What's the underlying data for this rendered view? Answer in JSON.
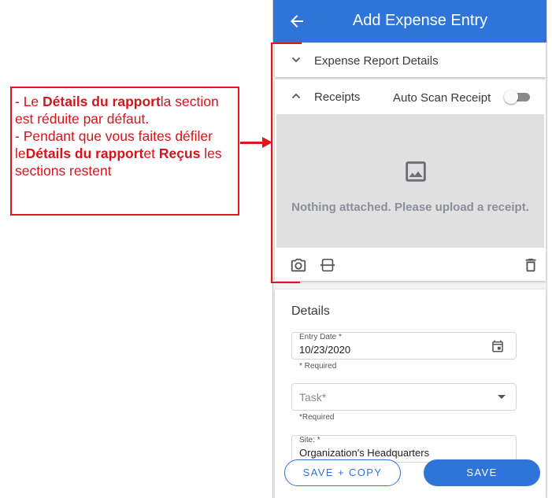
{
  "annotation": {
    "line1_prefix": "- Le ",
    "line1_bold": "Détails du rapport",
    "line1_suffix": "la section est réduite par défaut.",
    "line2_prefix": "- Pendant que vous faites défiler le",
    "line2_bold1": "Détails du rapport",
    "line2_mid": "et ",
    "line2_bold2": "Reçus",
    "line2_suffix": " les sections restent",
    "color": "#e0161d"
  },
  "header": {
    "title": "Add Expense Entry",
    "back_icon": "arrow-left-icon",
    "color": "#2f74d8"
  },
  "report_section": {
    "label": "Expense Report Details",
    "chevron_icon": "chevron-down-icon"
  },
  "receipts_section": {
    "label": "Receipts",
    "chevron_icon": "chevron-up-icon",
    "auto_scan_label": "Auto Scan Receipt",
    "auto_scan_enabled": false,
    "empty_message": "Nothing attached. Please upload a receipt.",
    "tools": [
      "camera-icon",
      "scanner-icon",
      "delete-icon"
    ]
  },
  "details_section": {
    "title": "Details",
    "entry_date": {
      "label": "Entry Date *",
      "value": "10/23/2020",
      "helper": "* Required"
    },
    "task": {
      "placeholder": "Task*",
      "helper": "*Required"
    },
    "site": {
      "label": "Site: *",
      "value": "Organization's Headquarters"
    }
  },
  "actions": {
    "save_copy": "SAVE + COPY",
    "save": "SAVE"
  }
}
